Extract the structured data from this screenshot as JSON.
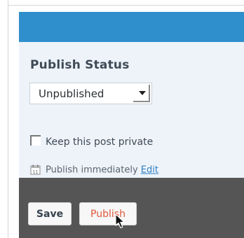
{
  "publish_panel": {
    "title": "Publish Status",
    "status_select": {
      "selected": "Unpublished"
    },
    "private_checkbox": {
      "label": "Keep this post private",
      "checked": false
    },
    "publish_time": {
      "label": "Publish immediately",
      "edit_link": "Edit"
    },
    "footer": {
      "save_label": "Save",
      "publish_label": "Publish"
    }
  },
  "colors": {
    "header": "#2f8fcc",
    "panel_background": "#eef3f9",
    "footer": "#555555",
    "publish_text": "#e0573a",
    "link": "#2f7fc4"
  },
  "icons": [
    "calendar-icon",
    "chevron-down-icon",
    "mouse-pointer-icon"
  ]
}
